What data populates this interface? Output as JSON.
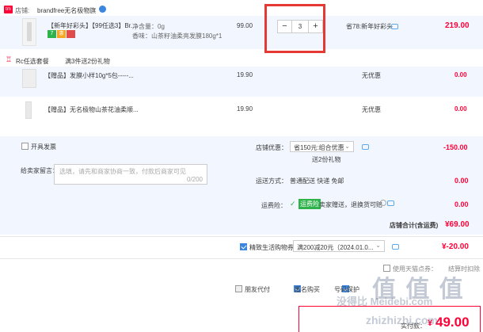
{
  "store": {
    "badge": "tm",
    "prefix": "店铺:",
    "name": "brandfree无名极物旗"
  },
  "product": {
    "tags": "【新年好彩头】【99任选3】Br...",
    "badge_a": "7",
    "badge_b": "惠",
    "spec_volume": "净含量：0g",
    "spec_scent": "香味：山茶籽油柔亮发膜180g*1",
    "price": "99.00",
    "qty": "3",
    "promo": "省78:新年好彩头",
    "subtotal": "219.00"
  },
  "bundle": {
    "title": "Rc任选套餐",
    "desc": "满3件送2份礼物"
  },
  "gifts": [
    {
      "name": "【赠品】发膜小样10g*5包-----...",
      "price": "19.90",
      "promo": "无优惠",
      "subtotal": "0.00"
    },
    {
      "name": "【赠品】无名极物山茶花油柔顺...",
      "price": "19.90",
      "promo": "无优惠",
      "subtotal": "0.00"
    }
  ],
  "invoice": {
    "label": "开具发票"
  },
  "message": {
    "label": "给卖家留言：",
    "placeholder": "选填，请先和商家协商一致，付款后商家可见",
    "counter": "0/200"
  },
  "shop_discount": {
    "label": "店铺优惠：",
    "selected": "省150元:组合优惠",
    "note": "送2份礼物",
    "amount": "-150.00"
  },
  "shipping": {
    "label": "运送方式：",
    "value": "普通配送 快递 免邮",
    "amount": "0.00"
  },
  "insurance": {
    "label": "运费险：",
    "badge": "运费险",
    "text": "卖家赠送，退换货可赔",
    "amount": "0.00"
  },
  "store_total": {
    "label": "店铺合计(含运费)",
    "amount": "¥69.00"
  },
  "coupon": {
    "label": "精致生活购物券",
    "selected": "满200减20元（2024.01.0...",
    "amount": "¥-20.00"
  },
  "points": {
    "label": "使用天猫点券：",
    "right": "结算时扣除"
  },
  "options": [
    {
      "label": "朋友代付",
      "checked": false
    },
    {
      "label": "匿名购买",
      "checked": true
    },
    {
      "label": "号码保护",
      "checked": true
    }
  ],
  "pay": {
    "label": "实付款：",
    "currency": "¥",
    "amount": "49.00"
  },
  "watermark": {
    "logo": "值 值 值",
    "line1": "没得比 Meidebi.com",
    "line2": "zhizhizhi.com"
  }
}
